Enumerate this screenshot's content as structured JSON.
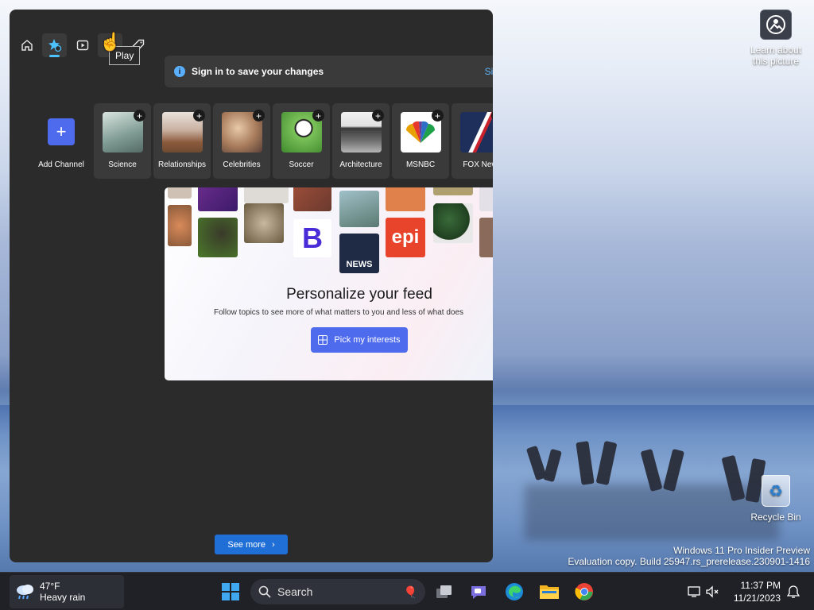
{
  "desktop": {
    "learn_label": "Learn about this picture",
    "recycle_label": "Recycle Bin",
    "watermark_line1": "Windows 11 Pro Insider Preview",
    "watermark_line2": "Evaluation copy. Build 25947.rs_prerelease.230901-1416"
  },
  "widgets": {
    "nav": [
      {
        "name": "home",
        "icon": "home-icon"
      },
      {
        "name": "discover",
        "icon": "star-icon"
      },
      {
        "name": "watch",
        "icon": "play-icon"
      },
      {
        "name": "play",
        "icon": "game-icon"
      },
      {
        "name": "shopping",
        "icon": "tag-icon"
      }
    ],
    "tooltip": "Play",
    "signin_text": "Sign in to save your changes",
    "signin_link": "Sig",
    "add_channel": "Add Channel",
    "channels": [
      {
        "label": "Science",
        "color": "#8aa8a0"
      },
      {
        "label": "Relationships",
        "color": "#b89478"
      },
      {
        "label": "Celebrities",
        "color": "#b78e6e"
      },
      {
        "label": "Soccer",
        "color": "#6fb24c"
      },
      {
        "label": "Architecture",
        "color": "#9aa0a8"
      },
      {
        "label": "MSNBC",
        "color": "#ffffff"
      },
      {
        "label": "FOX New",
        "color": "#1d2f5a"
      }
    ],
    "feed": {
      "title": "Personalize your feed",
      "subtitle": "Follow topics to see more of what matters to you and less of what does",
      "button": "Pick my interests",
      "logo_b": "B",
      "logo_news": "NEWS",
      "logo_epi": "epi"
    },
    "see_more": "See more"
  },
  "taskbar": {
    "temperature": "47°F",
    "condition": "Heavy rain",
    "search_label": "Search",
    "time": "11:37 PM",
    "date": "11/21/2023"
  }
}
